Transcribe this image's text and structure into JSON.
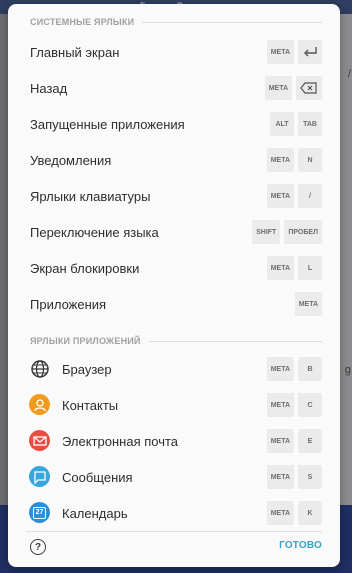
{
  "background": {
    "top_text": "Браузер Рольте",
    "right_fragment_1": "/",
    "right_fragment_2": "g"
  },
  "system_section": {
    "header": "СИСТЕМНЫЕ ЯРЛЫКИ",
    "items": [
      {
        "label": "Главный экран",
        "keys": [
          "META",
          "enter-icon"
        ]
      },
      {
        "label": "Назад",
        "keys": [
          "META",
          "backspace-icon"
        ]
      },
      {
        "label": "Запущенные приложения",
        "keys": [
          "ALT",
          "TAB"
        ]
      },
      {
        "label": "Уведомления",
        "keys": [
          "META",
          "N"
        ]
      },
      {
        "label": "Ярлыки клавиатуры",
        "keys": [
          "META",
          "/"
        ]
      },
      {
        "label": "Переключение языка",
        "keys": [
          "SHIFT",
          "ПРОБЕЛ"
        ]
      },
      {
        "label": "Экран блокировки",
        "keys": [
          "META",
          "L"
        ]
      },
      {
        "label": "Приложения",
        "keys": [
          "META"
        ]
      }
    ]
  },
  "apps_section": {
    "header": "ЯРЛЫКИ ПРИЛОЖЕНИЙ",
    "items": [
      {
        "label": "Браузер",
        "icon": "globe-icon",
        "keys": [
          "META",
          "B"
        ]
      },
      {
        "label": "Контакты",
        "icon": "contacts-icon",
        "keys": [
          "META",
          "C"
        ]
      },
      {
        "label": "Электронная почта",
        "icon": "email-icon",
        "keys": [
          "META",
          "E"
        ]
      },
      {
        "label": "Сообщения",
        "icon": "messages-icon",
        "keys": [
          "META",
          "S"
        ]
      },
      {
        "label": "Календарь",
        "icon": "calendar-icon",
        "keys": [
          "META",
          "K"
        ],
        "calendar_day": "27"
      }
    ]
  },
  "footer": {
    "help_symbol": "?",
    "done_label": "ГОТОВО"
  },
  "colors": {
    "accent": "#3aa0c8",
    "contacts": "#f39b1d",
    "email": "#ea4c3f",
    "messages": "#36a6dc",
    "calendar": "#2e8fd5"
  }
}
